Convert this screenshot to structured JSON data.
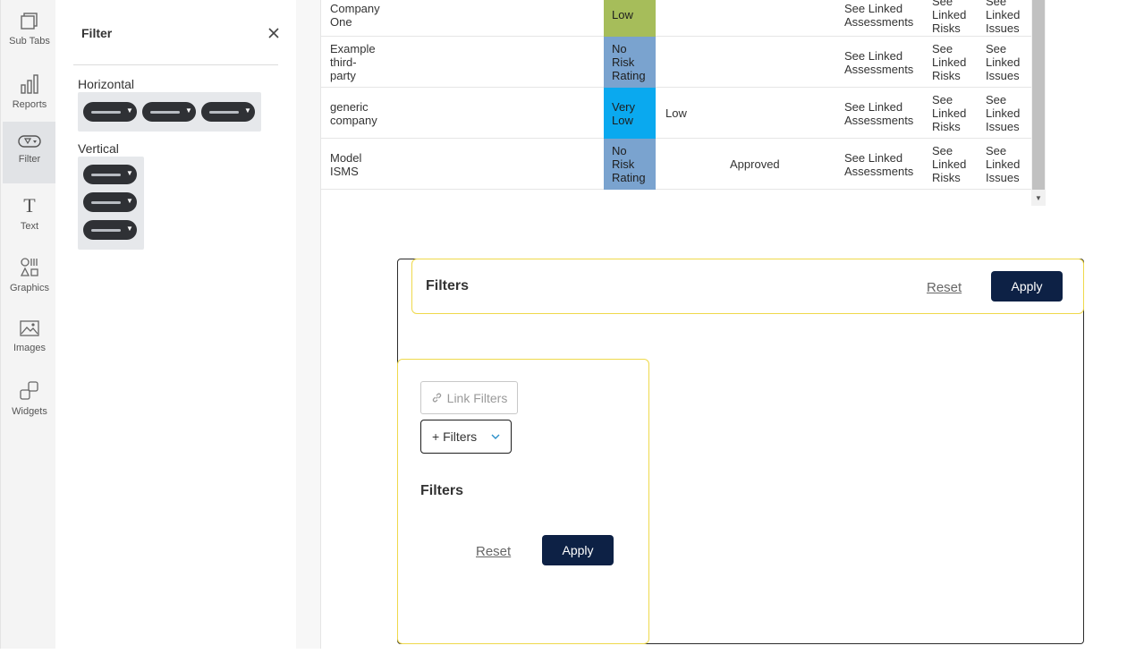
{
  "rail": {
    "items": [
      {
        "label": "Sub Tabs",
        "icon": "sub-tabs-icon",
        "active": false
      },
      {
        "label": "Reports",
        "icon": "bar-chart-icon",
        "active": false
      },
      {
        "label": "Filter",
        "icon": "filter-icon",
        "active": true
      },
      {
        "label": "Text",
        "icon": "text-icon",
        "active": false
      },
      {
        "label": "Graphics",
        "icon": "shapes-icon",
        "active": false
      },
      {
        "label": "Images",
        "icon": "image-icon",
        "active": false
      },
      {
        "label": "Widgets",
        "icon": "widgets-icon",
        "active": false
      }
    ]
  },
  "panel": {
    "title": "Filter",
    "horizontal_label": "Horizontal",
    "vertical_label": "Vertical"
  },
  "table": {
    "rows": [
      {
        "name": [
          "Company",
          "One"
        ],
        "rating": [
          "Low"
        ],
        "rating_color": "#a6bd5a",
        "col2": "",
        "col3": "",
        "assess": [
          "See Linked",
          "Assessments"
        ],
        "risks": [
          "See",
          "Linked",
          "Risks"
        ],
        "issues": [
          "See",
          "Linked",
          "Issues"
        ]
      },
      {
        "name": [
          "Example",
          "third-",
          "party"
        ],
        "rating": [
          "No",
          "Risk",
          "Rating"
        ],
        "rating_color": "#7aa3cf",
        "col2": "",
        "col3": "",
        "assess": [
          "See Linked",
          "Assessments"
        ],
        "risks": [
          "See",
          "Linked",
          "Risks"
        ],
        "issues": [
          "See",
          "Linked",
          "Issues"
        ]
      },
      {
        "name": [
          "generic",
          "company"
        ],
        "rating": [
          "Very",
          "Low"
        ],
        "rating_color": "#0aa9ef",
        "col2": "Low",
        "col3": "",
        "assess": [
          "See Linked",
          "Assessments"
        ],
        "risks": [
          "See",
          "Linked",
          "Risks"
        ],
        "issues": [
          "See",
          "Linked",
          "Issues"
        ]
      },
      {
        "name": [
          "Model",
          "ISMS"
        ],
        "rating": [
          "No",
          "Risk",
          "Rating"
        ],
        "rating_color": "#7aa3cf",
        "col2": "",
        "col3": "Approved",
        "assess": [
          "See Linked",
          "Assessments"
        ],
        "risks": [
          "See",
          "Linked",
          "Risks"
        ],
        "issues": [
          "See",
          "Linked",
          "Issues"
        ]
      }
    ]
  },
  "filters_horizontal": {
    "title": "Filters",
    "reset_label": "Reset",
    "apply_label": "Apply"
  },
  "filters_vertical": {
    "link_filters_label": "Link Filters",
    "add_filters_label": "+ Filters",
    "title": "Filters",
    "reset_label": "Reset",
    "apply_label": "Apply"
  },
  "colors": {
    "apply_button": "#0d2145",
    "highlight_border": "#efd94b"
  }
}
